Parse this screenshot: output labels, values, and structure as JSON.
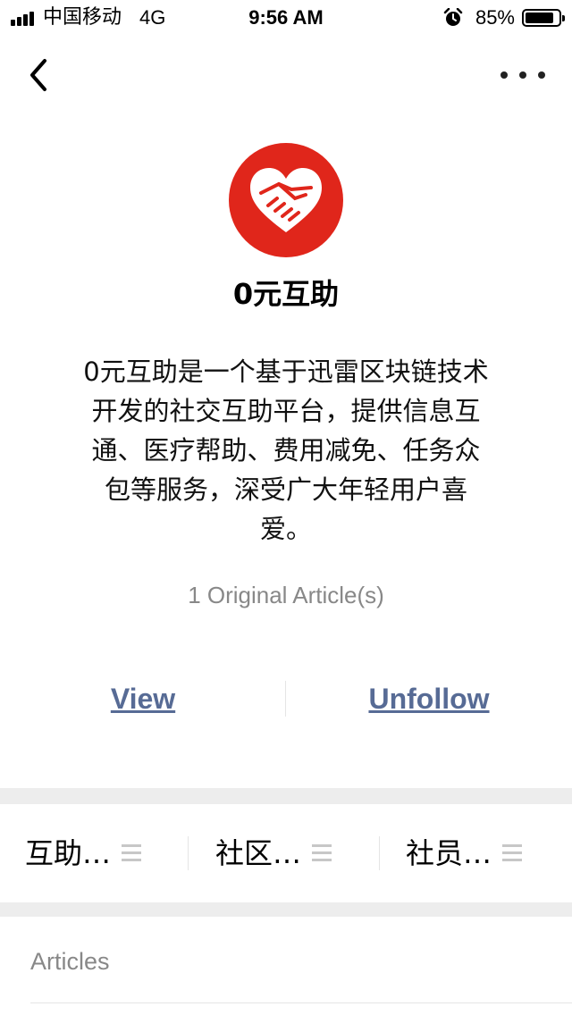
{
  "status_bar": {
    "carrier": "中国移动",
    "network": "4G",
    "time": "9:56 AM",
    "battery_percent": "85%",
    "battery_level": 0.85
  },
  "nav": {
    "back_icon": "chevron-left-icon",
    "more_icon": "more-dots-icon"
  },
  "profile": {
    "avatar_icon": "heart-handshake-icon",
    "avatar_color": "#e0261b",
    "name": "0元互助",
    "description": "0元互助是一个基于迅雷区块链技术开发的社交互助平台，提供信息互通、医疗帮助、费用减免、任务众包等服务，深受广大年轻用户喜爱。",
    "article_count": "1 Original Article(s)"
  },
  "actions": {
    "view_label": "View",
    "unfollow_label": "Unfollow",
    "link_color": "#576b95"
  },
  "menu": {
    "items": [
      {
        "label": "互助…",
        "icon": "menu-lines-icon"
      },
      {
        "label": "社区…",
        "icon": "menu-lines-icon"
      },
      {
        "label": "社员…",
        "icon": "menu-lines-icon"
      }
    ]
  },
  "articles": {
    "title": "Articles"
  }
}
